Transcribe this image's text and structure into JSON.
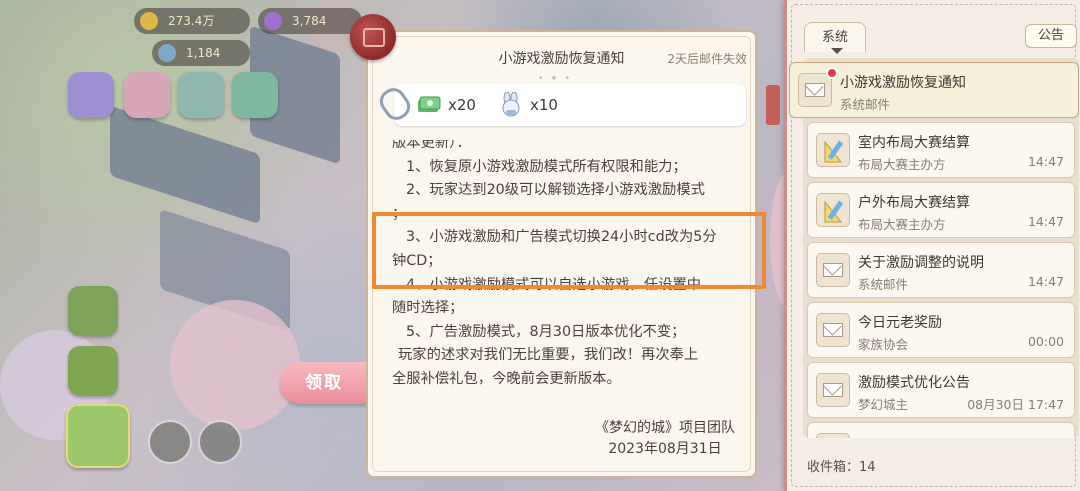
{
  "hud": {
    "currency1": "273.4万",
    "currency2": "3,784",
    "currency3": "1,184"
  },
  "claim_label": "领取",
  "letter": {
    "title": "小游戏激励恢复通知",
    "expiry": "2天后邮件失效",
    "attachments": [
      {
        "icon": "cash-bundle-icon",
        "qty": "x20"
      },
      {
        "icon": "bunny-doll-icon",
        "qty": "x10"
      }
    ],
    "body": [
      "版本更新）：",
      "1、恢复原小游戏激励模式所有权限和能力；",
      "2、玩家达到20级可以解锁选择小游戏激励模式",
      "；",
      "3、小游戏激励和广告模式切换24小时cd改为5分",
      "钟CD；",
      "4、小游戏激励模式可以自选小游戏，任设置中",
      "随时选择；",
      "5、广告激励模式，8月30日版本优化不变；",
      "玩家的述求对我们无比重要，我们改！再次奉上",
      "全服补偿礼包，今晚前会更新版本。"
    ],
    "signature_team": "《梦幻的城》项目团队",
    "signature_date": "2023年08月31日"
  },
  "mail": {
    "tab_system": "系统",
    "notice_button": "公告",
    "items": [
      {
        "title": "小游戏激励恢复通知",
        "sender": "系统邮件",
        "time": "",
        "icon": "envelope-icon",
        "selected": true,
        "unread": true
      },
      {
        "title": "室内布局大赛结算",
        "sender": "布局大赛主办方",
        "time": "14:47",
        "icon": "ruler-pencil-icon"
      },
      {
        "title": "户外布局大赛结算",
        "sender": "布局大赛主办方",
        "time": "14:47",
        "icon": "ruler-pencil-icon"
      },
      {
        "title": "关于激励调整的说明",
        "sender": "系统邮件",
        "time": "14:47",
        "icon": "envelope-icon"
      },
      {
        "title": "今日元老奖励",
        "sender": "家族协会",
        "time": "00:00",
        "icon": "envelope-icon"
      },
      {
        "title": "激励模式优化公告",
        "sender": "梦幻城主",
        "time": "08月30日 17:47",
        "icon": "envelope-icon"
      }
    ],
    "inbox_count": "收件箱：14"
  },
  "colors": {
    "highlight": "#f08a30",
    "claim": "#ea8e9b",
    "unread_dot": "#e83a3a"
  }
}
